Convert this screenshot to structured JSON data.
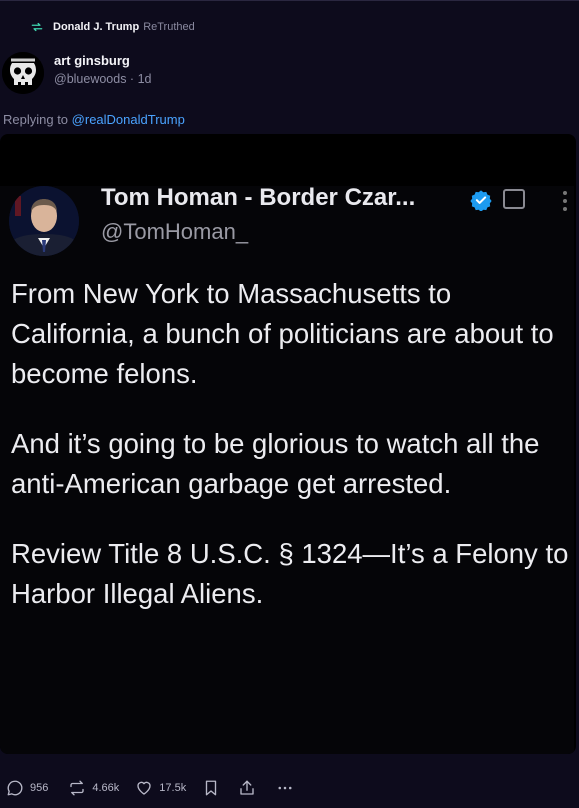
{
  "retruth": {
    "user": "Donald J. Trump",
    "label": "ReTruthed"
  },
  "author": {
    "name": "art ginsburg",
    "handle": "@bluewoods",
    "time": "1d",
    "meta": "@bluewoods · 1d"
  },
  "reply": {
    "prefix": "Replying to",
    "mention": "@realDonaldTrump"
  },
  "embedded_post": {
    "name": "Tom Homan - Border Czar...",
    "handle": "@TomHoman_",
    "paragraphs": [
      "From New York to Massachusetts to California, a bunch of politicians are about to become felons.",
      "And it’s going to be glorious to watch all the anti-American garbage get arrested.",
      "Review Title 8 U.S.C. § 1324—It’s a Felony to Harbor Illegal Aliens."
    ]
  },
  "actions": {
    "replies": "956",
    "retruths": "4.66k",
    "likes": "17.5k"
  },
  "colors": {
    "background": "#0d0b1c",
    "mention": "#4aa3ff",
    "verified": "#1d9bf0",
    "retruth_icon": "#3fd6b0"
  },
  "icons": [
    "retruth-icon",
    "reply-icon",
    "heart-icon",
    "bookmark-icon",
    "share-icon",
    "more-icon",
    "verified-icon"
  ]
}
